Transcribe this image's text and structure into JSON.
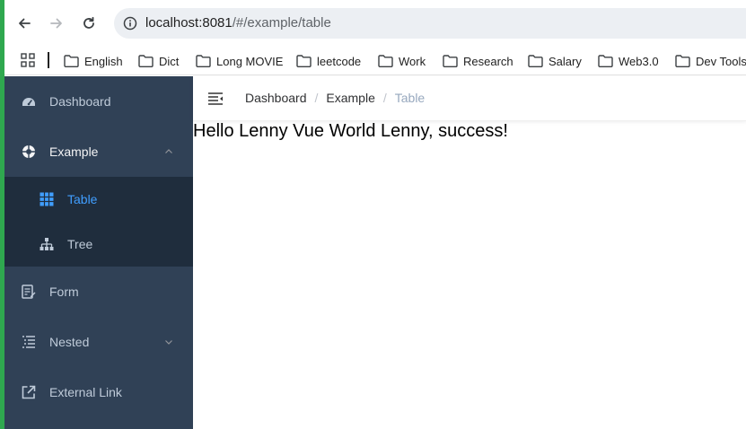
{
  "browser": {
    "url_host": "localhost:8081",
    "url_path": "/#/example/table",
    "bookmarks": [
      {
        "label": "English"
      },
      {
        "label": "Dict"
      },
      {
        "label": "Long MOVIE"
      },
      {
        "label": "leetcode"
      },
      {
        "label": "Work"
      },
      {
        "label": "Research"
      },
      {
        "label": "Salary"
      },
      {
        "label": "Web3.0"
      },
      {
        "label": "Dev Tools"
      }
    ]
  },
  "sidebar": {
    "items": [
      {
        "label": "Dashboard",
        "icon": "dashboard-icon"
      },
      {
        "label": "Example",
        "icon": "example-icon",
        "expanded": true
      },
      {
        "label": "Form",
        "icon": "form-icon"
      },
      {
        "label": "Nested",
        "icon": "nested-icon"
      },
      {
        "label": "External Link",
        "icon": "external-link-icon"
      }
    ],
    "subitems": [
      {
        "label": "Table",
        "icon": "table-icon",
        "active": true
      },
      {
        "label": "Tree",
        "icon": "tree-icon"
      }
    ]
  },
  "breadcrumb": {
    "items": [
      "Dashboard",
      "Example",
      "Table"
    ],
    "separator": "/"
  },
  "main": {
    "message": "Hello Lenny Vue World Lenny, success!"
  },
  "colors": {
    "sidebar_bg": "#304156",
    "submenu_bg": "#1f2d3d",
    "active": "#409eff"
  }
}
